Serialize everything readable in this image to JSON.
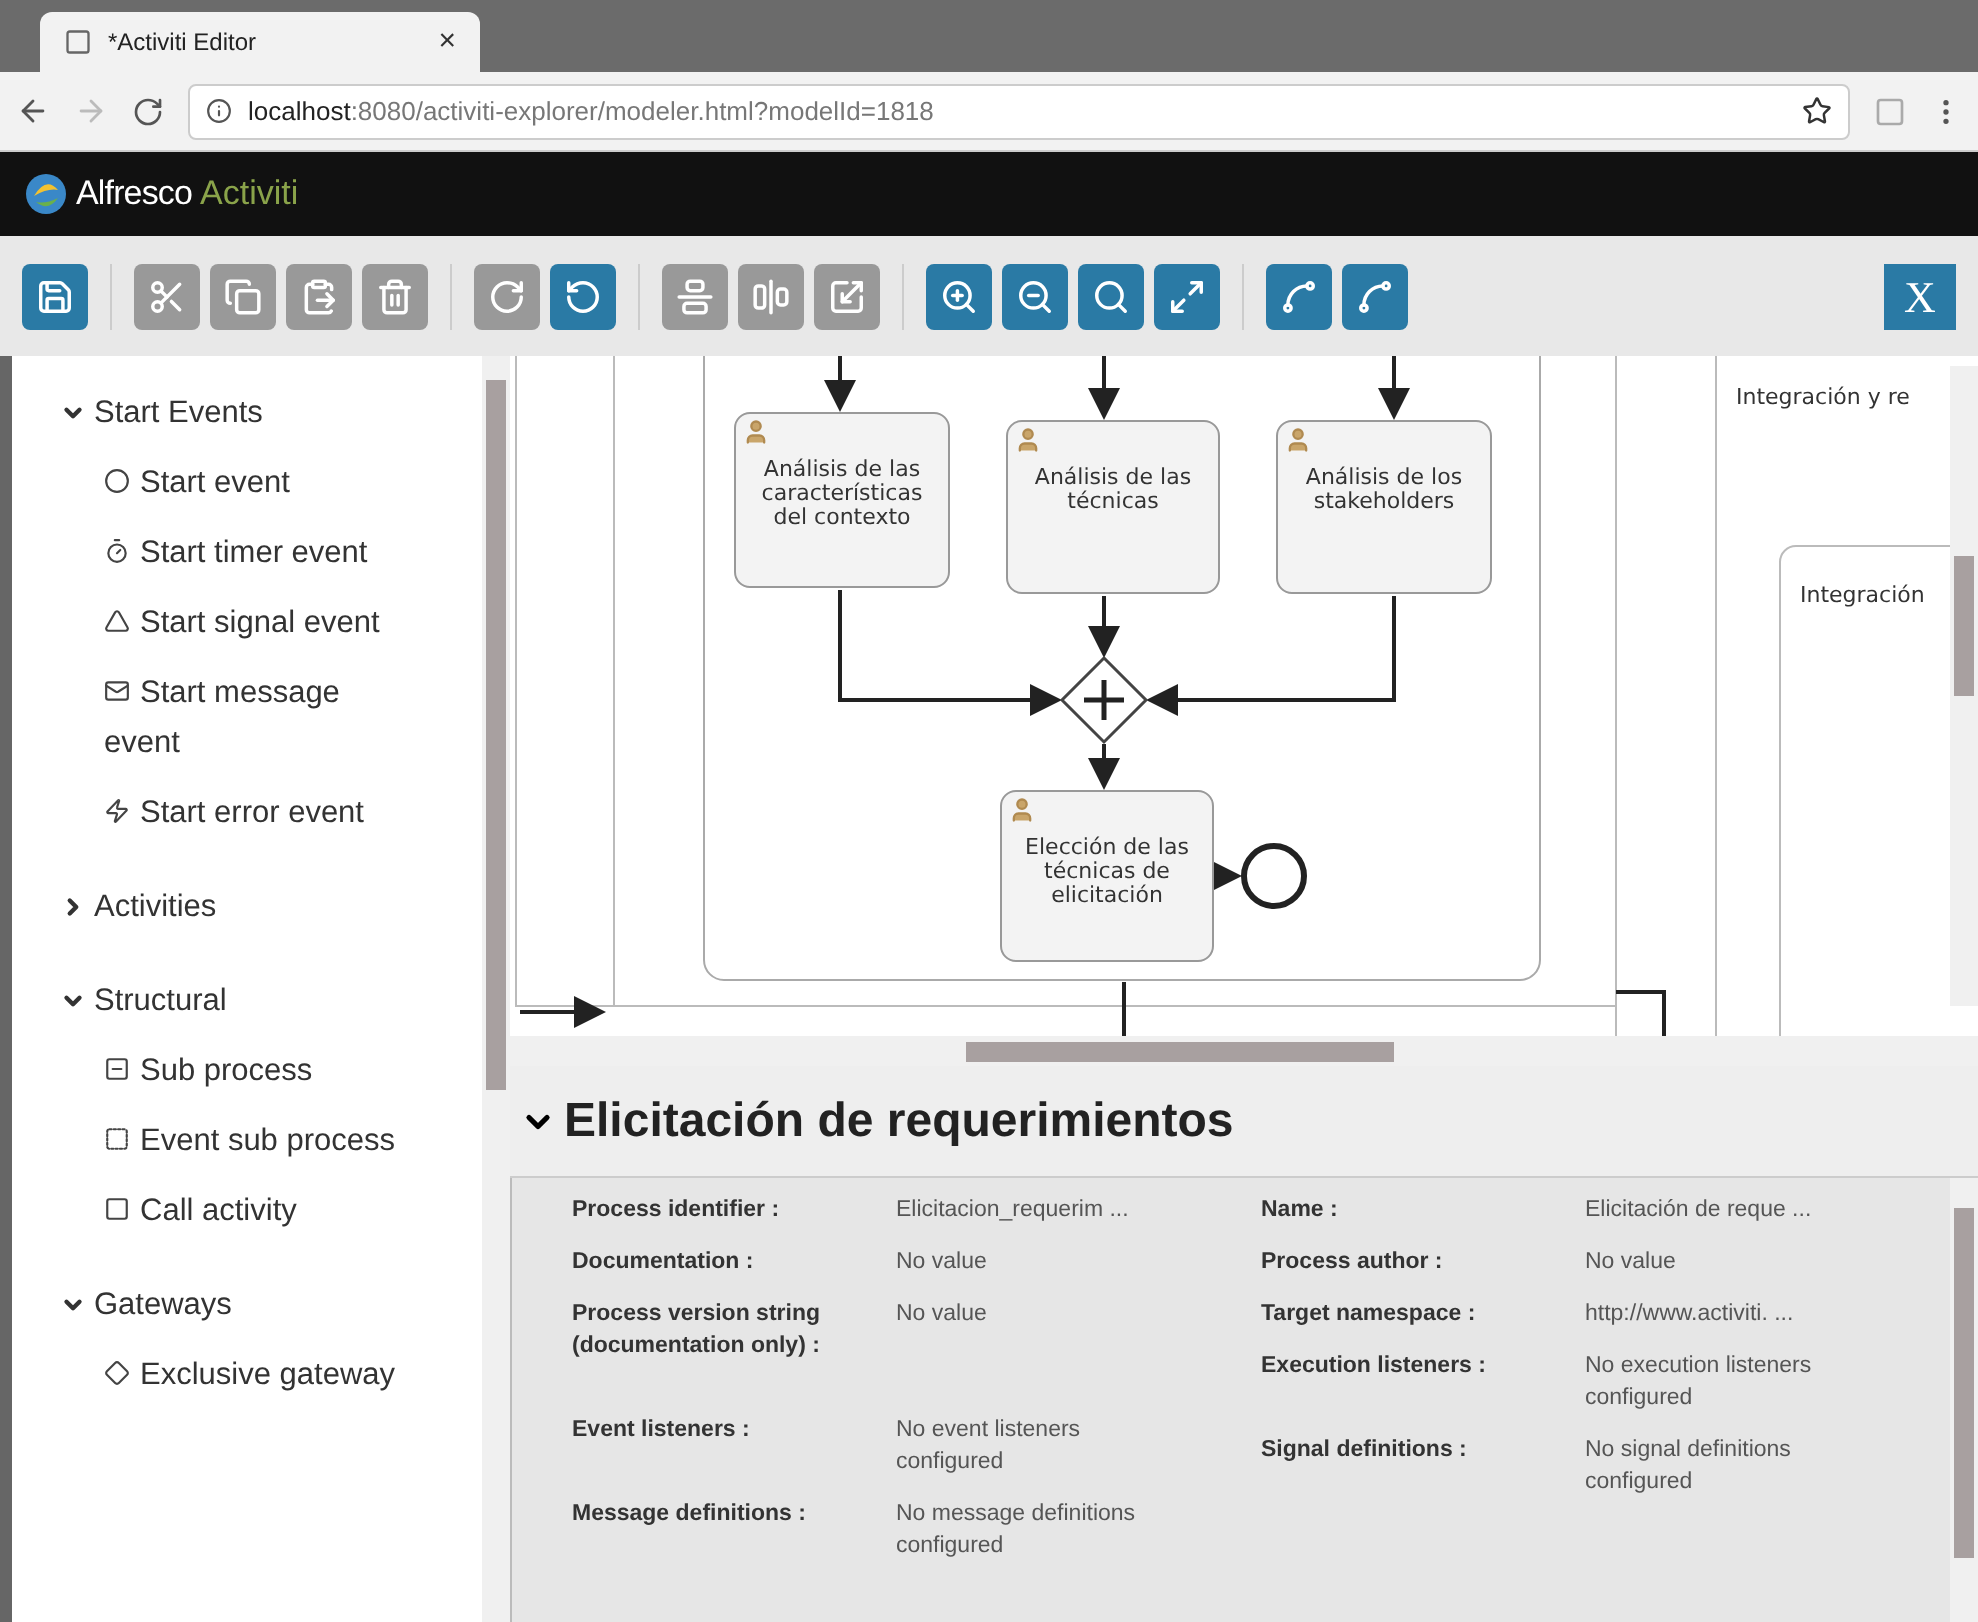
{
  "browser": {
    "tab_title": "*Activiti Editor",
    "tab_close": "×",
    "url_host": "localhost",
    "url_rest": ":8080/activiti-explorer/modeler.html?modelId=1818"
  },
  "app": {
    "brand": "Alfresco",
    "product": "Activiti"
  },
  "toolbar": {
    "groups": [
      [
        {
          "kind": "save",
          "enabled": true
        }
      ],
      [
        {
          "kind": "cut",
          "enabled": false
        },
        {
          "kind": "copy",
          "enabled": false
        },
        {
          "kind": "paste",
          "enabled": false
        },
        {
          "kind": "delete",
          "enabled": false
        }
      ],
      [
        {
          "kind": "redo",
          "enabled": false
        },
        {
          "kind": "undo",
          "enabled": true
        }
      ],
      [
        {
          "kind": "alignh",
          "enabled": false
        },
        {
          "kind": "alignv",
          "enabled": false
        },
        {
          "kind": "size",
          "enabled": false
        }
      ],
      [
        {
          "kind": "zoomin",
          "enabled": true
        },
        {
          "kind": "zoomout",
          "enabled": true
        },
        {
          "kind": "zoomactual",
          "enabled": true
        },
        {
          "kind": "zoomfit",
          "enabled": true
        }
      ],
      [
        {
          "kind": "addbend",
          "enabled": true
        },
        {
          "kind": "removebend",
          "enabled": true
        }
      ]
    ],
    "close_label": "X"
  },
  "palette": [
    {
      "label": "Start Events",
      "expanded": true,
      "items": [
        {
          "label": "Start event",
          "kind": "none"
        },
        {
          "label": "Start timer event",
          "kind": "timer"
        },
        {
          "label": "Start signal event",
          "kind": "signal"
        },
        {
          "label": "Start message event",
          "kind": "message"
        },
        {
          "label": "Start error event",
          "kind": "error"
        }
      ]
    },
    {
      "label": "Activities",
      "expanded": false
    },
    {
      "label": "Structural",
      "expanded": true,
      "items": [
        {
          "label": "Sub process",
          "kind": "subprocess"
        },
        {
          "label": "Event sub process",
          "kind": "eventsub"
        },
        {
          "label": "Call activity",
          "kind": "call"
        }
      ]
    },
    {
      "label": "Gateways",
      "expanded": true,
      "items": [
        {
          "label": "Exclusive gateway",
          "kind": "exclusive"
        }
      ]
    }
  ],
  "diagram": {
    "tasks": [
      {
        "label": "Análisis de las características del contexto"
      },
      {
        "label": "Análisis de las técnicas"
      },
      {
        "label": "Análisis de los stakeholders"
      },
      {
        "label": "Elección de las técnicas de elicitación"
      }
    ],
    "lane_labels": [
      "Integración y re",
      "Integración"
    ]
  },
  "properties": {
    "title": "Elicitación de requerimientos",
    "expanded": true,
    "left": [
      {
        "label": "Process identifier :",
        "value": "Elicitacion_requerim ..."
      },
      {
        "label": "Documentation :",
        "value": "No value"
      },
      {
        "label": "Process version string (documentation only) :",
        "value": "No value"
      },
      {
        "label": "Event listeners :",
        "value": "No event listeners configured"
      },
      {
        "label": "Message definitions :",
        "value": "No message definitions configured"
      }
    ],
    "right": [
      {
        "label": "Name :",
        "value": "Elicitación de reque ..."
      },
      {
        "label": "Process author :",
        "value": "No value"
      },
      {
        "label": "Target namespace :",
        "value": "http://www.activiti. ..."
      },
      {
        "label": "Execution listeners :",
        "value": "No execution listeners configured"
      },
      {
        "label": "Signal definitions :",
        "value": "No signal definitions configured"
      }
    ]
  }
}
